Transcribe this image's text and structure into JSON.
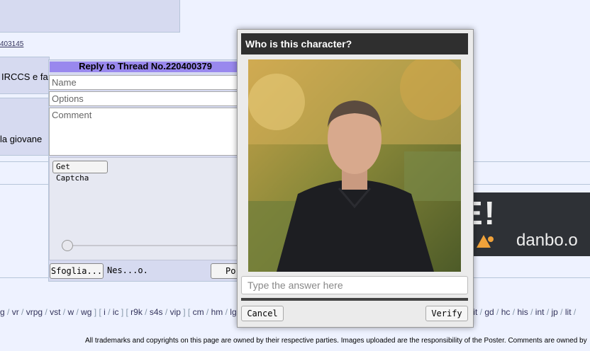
{
  "post_link": "403145",
  "post_text_1": "IRCCS e fa",
  "post_text_2": "la giovane",
  "reply_form": {
    "title": "Reply to Thread No.220400379",
    "name_placeholder": "Name",
    "options_placeholder": "Options",
    "comment_placeholder": "Comment",
    "get_captcha": "Get Captcha",
    "browse": "Sfoglia...",
    "file_status": "Nes...o.",
    "post_button": "Po"
  },
  "banner": {
    "big_text": "E!",
    "logo_text": "danbo.o"
  },
  "board_nav": [
    {
      "label": "g",
      "sep": "/"
    },
    {
      "label": "vr",
      "sep": "/"
    },
    {
      "label": "vrpg",
      "sep": "/"
    },
    {
      "label": "vst",
      "sep": "/"
    },
    {
      "label": "w",
      "sep": "/"
    },
    {
      "label": "wg",
      "sep": "] ["
    },
    {
      "label": "i",
      "sep": "/"
    },
    {
      "label": "ic",
      "sep": "] ["
    },
    {
      "label": "r9k",
      "sep": "/"
    },
    {
      "label": "s4s",
      "sep": "/"
    },
    {
      "label": "vip",
      "sep": "] ["
    },
    {
      "label": "cm",
      "sep": "/"
    },
    {
      "label": "hm",
      "sep": "/"
    },
    {
      "label": "lg",
      "sep": ""
    }
  ],
  "board_nav_right": [
    {
      "label": "fit",
      "sep": "/"
    },
    {
      "label": "gd",
      "sep": "/"
    },
    {
      "label": "hc",
      "sep": "/"
    },
    {
      "label": "his",
      "sep": "/"
    },
    {
      "label": "int",
      "sep": "/"
    },
    {
      "label": "jp",
      "sep": "/"
    },
    {
      "label": "lit",
      "sep": "/"
    }
  ],
  "footer_text": "All trademarks and copyrights on this page are owned by their respective parties. Images uploaded are the responsibility of the Poster. Comments are owned by",
  "captcha": {
    "question": "Who is this character?",
    "answer_placeholder": "Type the answer here",
    "cancel": "Cancel",
    "verify": "Verify"
  },
  "colors": {
    "qr_title_bg": "#9988ee",
    "modal_header_bg": "#2f2f2f",
    "banner_bg": "#2e3136",
    "link": "#34345c"
  }
}
